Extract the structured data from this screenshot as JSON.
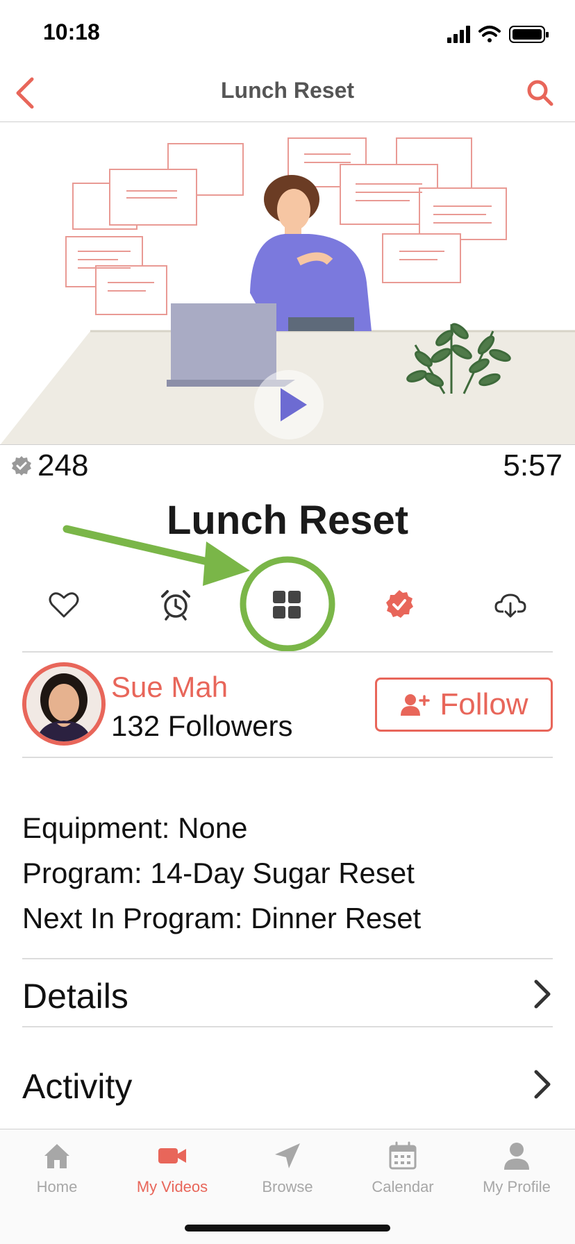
{
  "status_bar": {
    "time": "10:18"
  },
  "nav": {
    "title": "Lunch Reset"
  },
  "video": {
    "views": "248",
    "duration": "5:57",
    "title": "Lunch Reset"
  },
  "actions": [
    {
      "icon": "heart-icon"
    },
    {
      "icon": "alarm-clock-icon"
    },
    {
      "icon": "grid-icon",
      "highlighted": true
    },
    {
      "icon": "check-badge-icon",
      "color": "#e8665a"
    },
    {
      "icon": "cloud-download-icon"
    }
  ],
  "author": {
    "name": "Sue Mah",
    "followers": "132 Followers",
    "follow_label": "Follow"
  },
  "info": {
    "equipment": "Equipment: None",
    "program": "Program: 14-Day Sugar Reset",
    "next": "Next In Program: Dinner Reset"
  },
  "rows": {
    "details": "Details",
    "activity": "Activity"
  },
  "tabs": [
    {
      "label": "Home",
      "icon": "home-icon",
      "active": false
    },
    {
      "label": "My Videos",
      "icon": "video-camera-icon",
      "active": true
    },
    {
      "label": "Browse",
      "icon": "navigation-arrow-icon",
      "active": false
    },
    {
      "label": "Calendar",
      "icon": "calendar-icon",
      "active": false
    },
    {
      "label": "My Profile",
      "icon": "person-icon",
      "active": false
    }
  ],
  "colors": {
    "accent": "#e8665a",
    "highlight_annotation": "#7ab648"
  }
}
